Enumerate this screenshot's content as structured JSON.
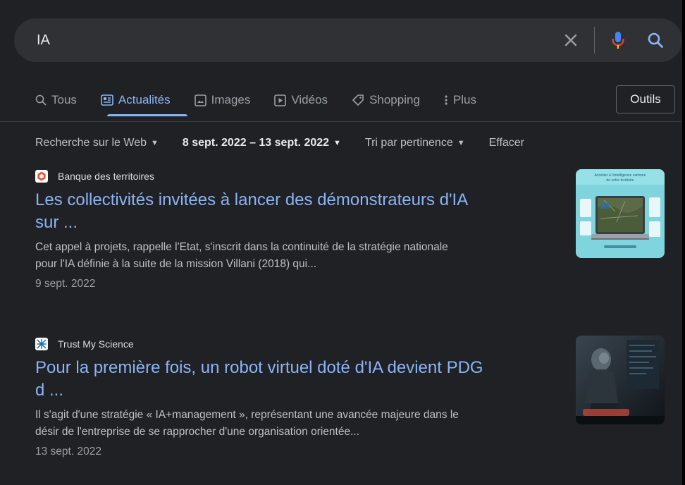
{
  "search": {
    "query": "IA"
  },
  "tabs": [
    {
      "label": "Tous",
      "icon": "search-icon",
      "active": false
    },
    {
      "label": "Actualités",
      "icon": "news-icon",
      "active": true
    },
    {
      "label": "Images",
      "icon": "image-icon",
      "active": false
    },
    {
      "label": "Vidéos",
      "icon": "video-icon",
      "active": false
    },
    {
      "label": "Shopping",
      "icon": "tag-icon",
      "active": false
    },
    {
      "label": "Plus",
      "icon": "more-vert-icon",
      "active": false
    }
  ],
  "tools": {
    "label": "Outils"
  },
  "filters": {
    "web": "Recherche sur le Web",
    "date_range": "8 sept. 2022 – 13 sept. 2022",
    "sort": "Tri par pertinence",
    "clear": "Effacer"
  },
  "results": [
    {
      "source": "Banque des territoires",
      "title_line1": "Les collectivités invitées à lancer des démonstrateurs d'IA",
      "title_line2": "sur ...",
      "snippet_line1": "Cet appel à projets, rappelle l'Etat, s'inscrit dans la continuité de la stratégie nationale",
      "snippet_line2": "pour l'IA définie à la suite de la mission Villani (2018) qui...",
      "date": "9 sept. 2022",
      "thumb_caption_1": "Accéder à l'intelligence carbone",
      "thumb_caption_2": "de votre territoire"
    },
    {
      "source": "Trust My Science",
      "title_line1": "Pour la première fois, un robot virtuel doté d'IA devient PDG",
      "title_line2": "d ...",
      "snippet_line1": "Il s'agit d'une stratégie « IA+management », représentant une avancée majeure dans le",
      "snippet_line2": "désir de l'entreprise de se rapprocher d'une organisation orientée...",
      "date": "13 sept. 2022"
    }
  ],
  "colors": {
    "background": "#202124",
    "link": "#8ab4f8",
    "text": "#bdc1c6",
    "search_bar": "#303134"
  }
}
